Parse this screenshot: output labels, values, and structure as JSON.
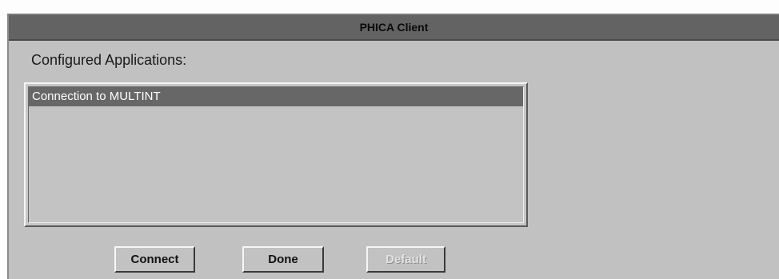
{
  "window": {
    "title": "PHICA Client"
  },
  "main": {
    "section_label": "Configured Applications:",
    "applications": [
      {
        "label": "Connection to MULTINT",
        "selected": true
      }
    ]
  },
  "buttons": {
    "connect": "Connect",
    "done": "Done",
    "default": "Default",
    "default_enabled": false
  },
  "colors": {
    "titlebar": "#636363",
    "window_bg": "#c1c1c1",
    "selection": "#676767",
    "selection_text": "#ffffff"
  }
}
